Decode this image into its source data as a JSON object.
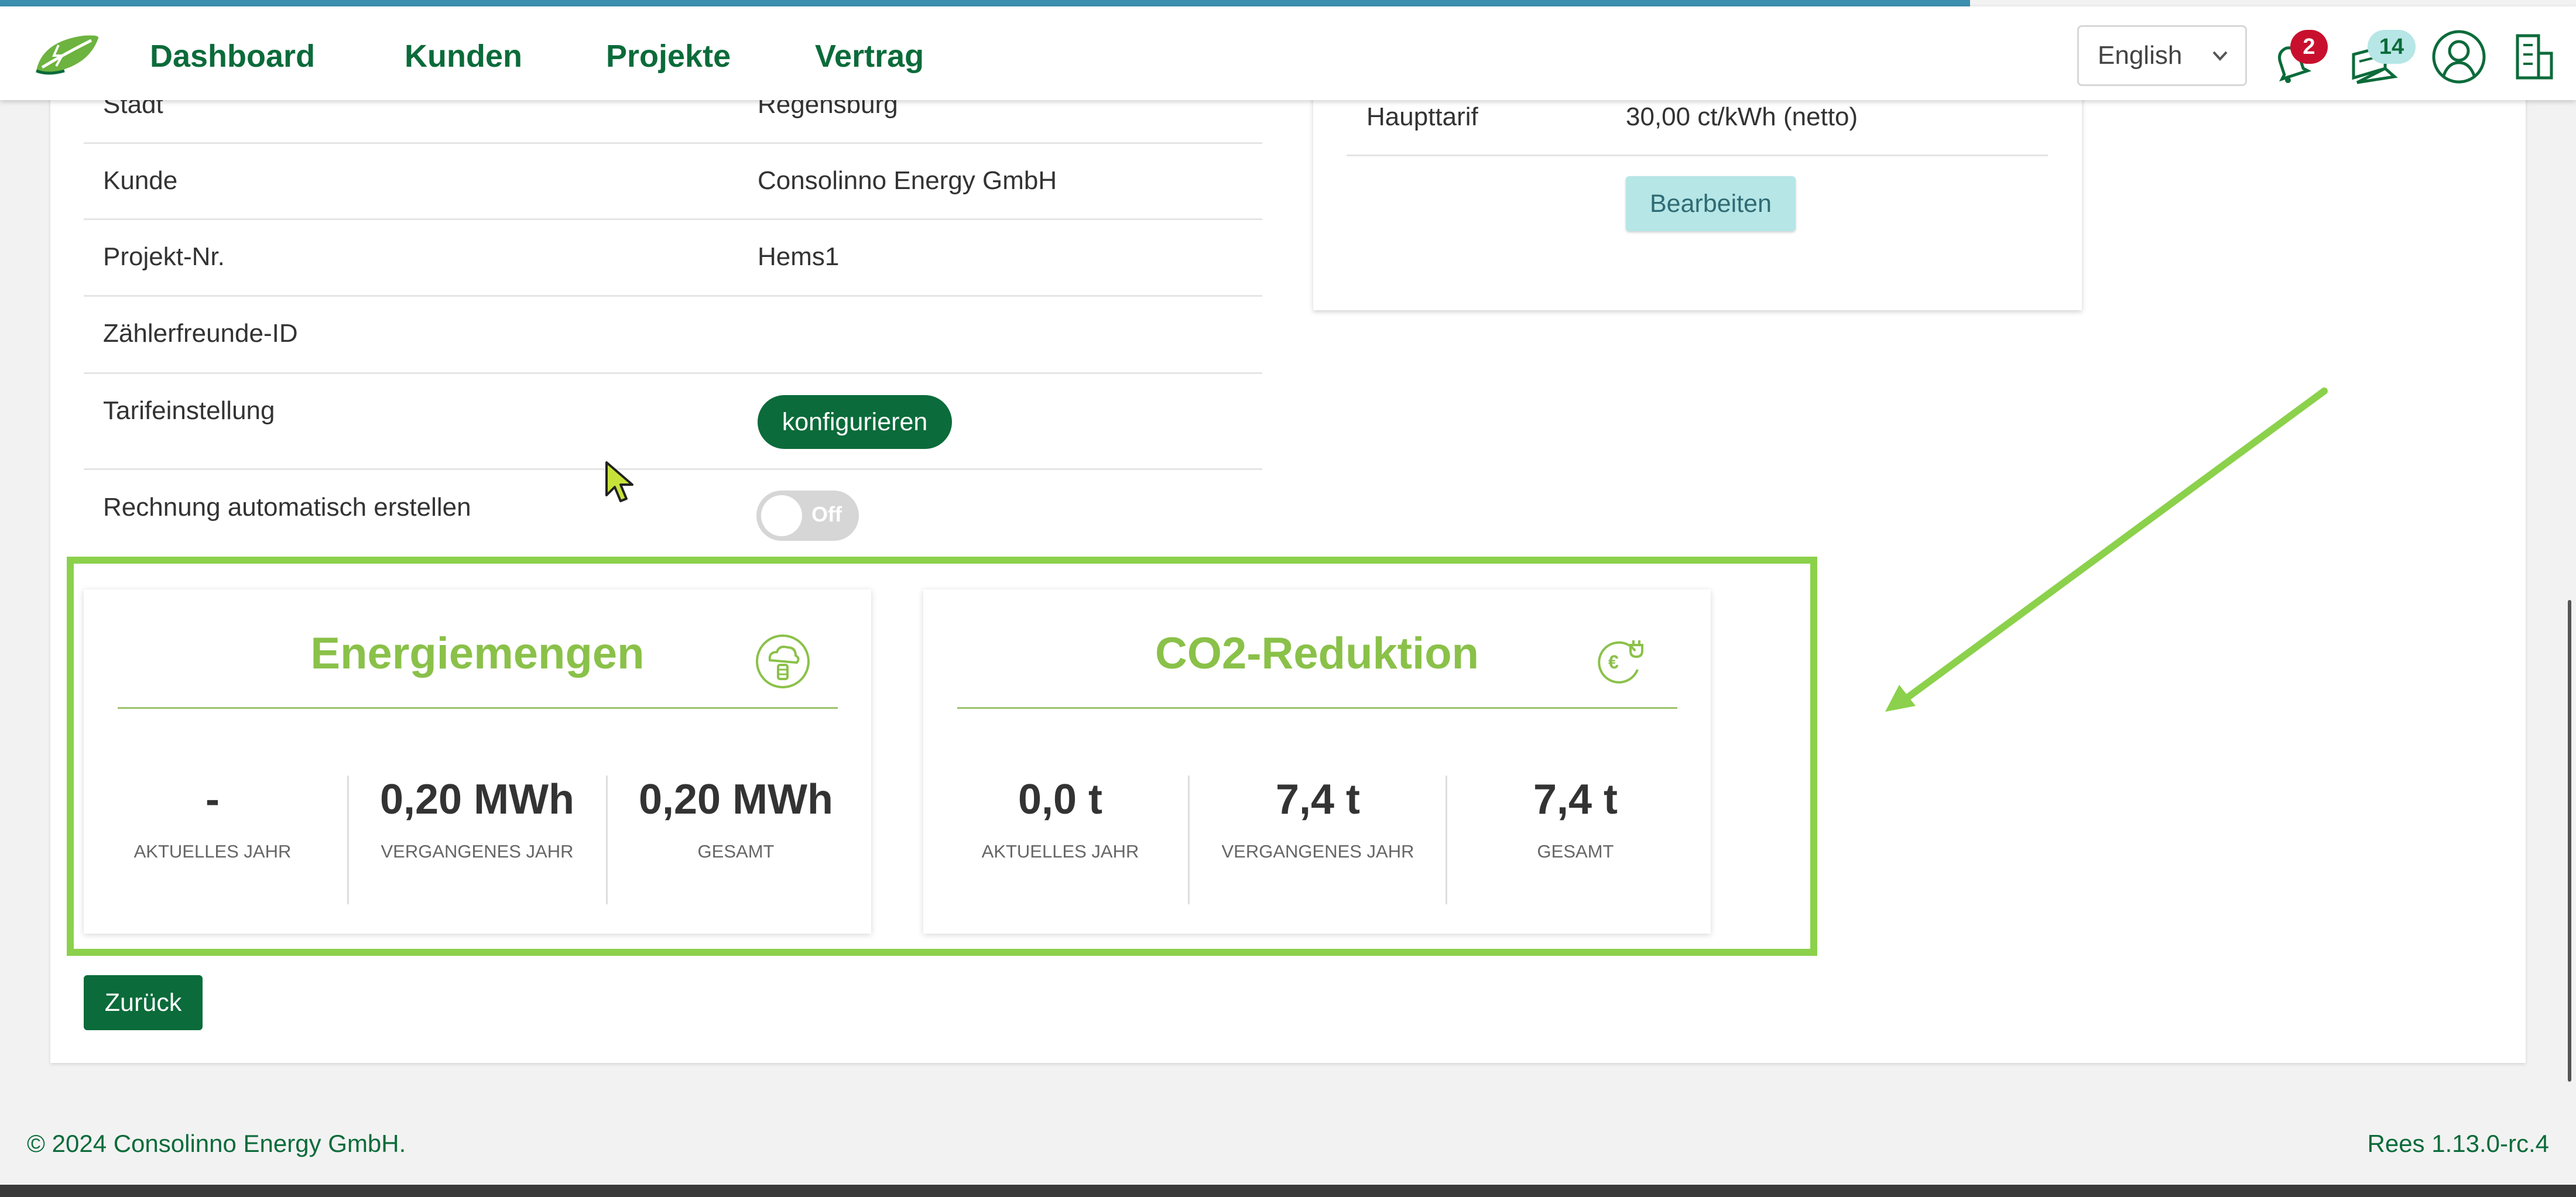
{
  "nav": {
    "items": [
      "Dashboard",
      "Kunden",
      "Projekte",
      "Vertrag"
    ]
  },
  "header": {
    "language": "English",
    "notifications_count": "2",
    "messages_count": "14",
    "icons": [
      "bell-icon",
      "news-icon",
      "user-avatar-icon",
      "building-icon"
    ]
  },
  "project": {
    "rows": [
      {
        "label": "Stadt",
        "value": "Regensburg"
      },
      {
        "label": "Kunde",
        "value": "Consolinno Energy GmbH"
      },
      {
        "label": "Projekt-Nr.",
        "value": "Hems1"
      },
      {
        "label": "Zählerfreunde-ID",
        "value": ""
      },
      {
        "label": "Tarifeinstellung",
        "value": ""
      },
      {
        "label": "Rechnung automatisch erstellen",
        "value": ""
      }
    ],
    "configure_label": "konfigurieren",
    "toggle_label": "Off",
    "toggle_on": false
  },
  "tariff": {
    "label": "Haupttarif",
    "value": "30,00 ct/kWh (netto)",
    "edit_label": "Bearbeiten"
  },
  "energy": {
    "title": "Energiemengen",
    "icon": "energy-cloud-icon",
    "stats": [
      {
        "value": "-",
        "label": "AKTUELLES JAHR"
      },
      {
        "value": "0,20 MWh",
        "label": "VERGANGENES JAHR"
      },
      {
        "value": "0,20 MWh",
        "label": "GESAMT"
      }
    ]
  },
  "co2": {
    "title": "CO2-Reduktion",
    "icon": "euro-plug-icon",
    "stats": [
      {
        "value": "0,0 t",
        "label": "AKTUELLES JAHR"
      },
      {
        "value": "7,4 t",
        "label": "VERGANGENES JAHR"
      },
      {
        "value": "7,4 t",
        "label": "GESAMT"
      }
    ]
  },
  "back_label": "Zurück",
  "footer": {
    "copyright": "© 2024 Consolinno Energy GmbH.",
    "version": "Rees 1.13.0-rc.4"
  },
  "colors": {
    "brand_green": "#0b6b3a",
    "accent_green": "#8ac149",
    "highlight_green": "#8bd14b",
    "badge_red": "#c8102e",
    "badge_teal": "#b6e6e6"
  }
}
